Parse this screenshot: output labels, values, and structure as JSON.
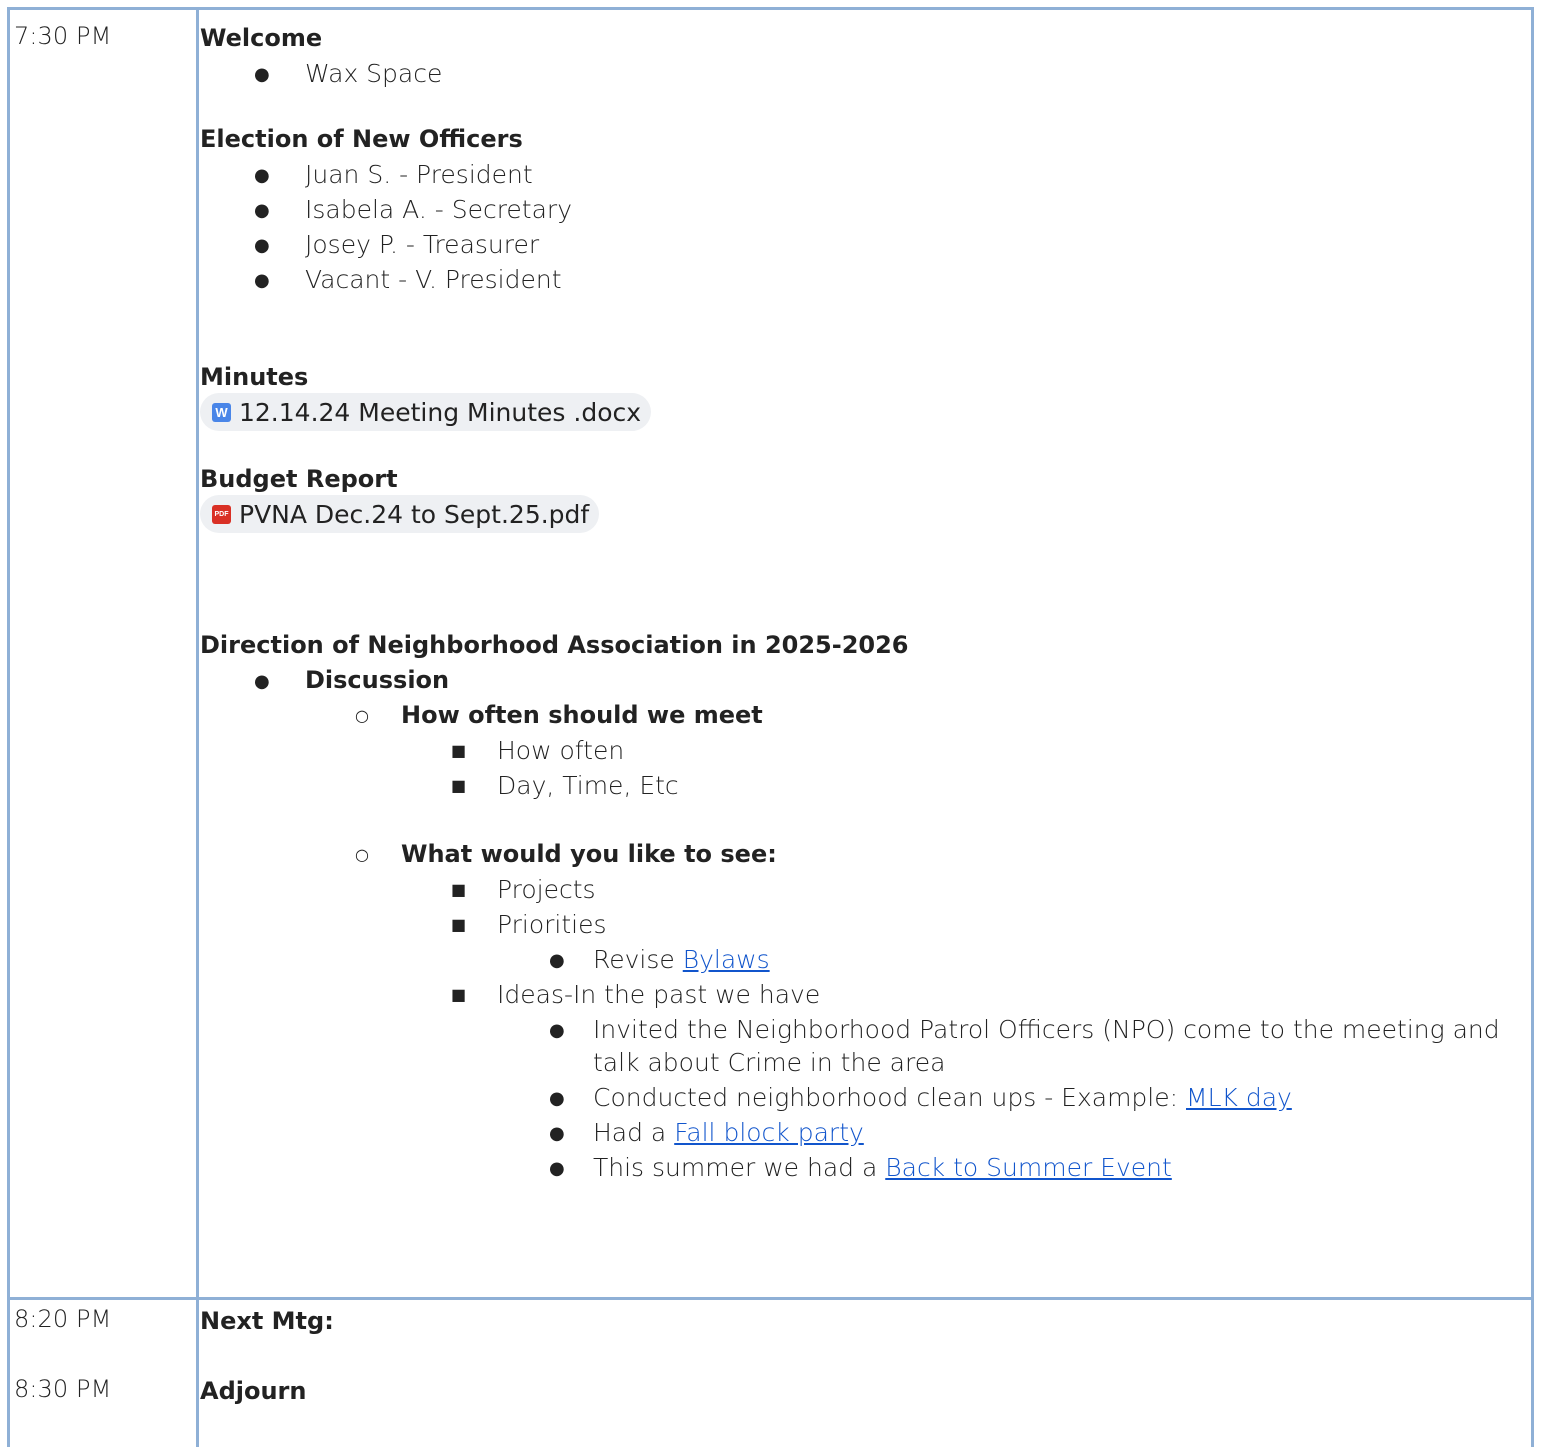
{
  "rows": [
    {
      "time": "7:30 PM",
      "sections": {
        "welcome": {
          "title": "Welcome",
          "items": [
            "Wax Space"
          ]
        },
        "election": {
          "title": "Election of New Officers",
          "items": [
            "Juan S. - President",
            "Isabela A. - Secretary",
            "Josey P. - Treasurer",
            "Vacant - V. President"
          ]
        },
        "minutes": {
          "title": "Minutes",
          "file": "12.14.24 Meeting Minutes .docx",
          "file_icon": "word-doc-icon"
        },
        "budget": {
          "title": "Budget Report",
          "file": "PVNA Dec.24 to Sept.25.pdf",
          "file_icon": "pdf-icon"
        },
        "direction": {
          "title": "Direction of Neighborhood Association in 2025-2026",
          "discussion": "Discussion",
          "meet": {
            "title": "How often should we meet",
            "items": [
              "How often",
              "Day, Time, Etc"
            ]
          },
          "see": {
            "title": "What would you like to see:",
            "projects": "Projects",
            "priorities": "Priorities",
            "revise_prefix": "Revise ",
            "revise_link": "Bylaws",
            "ideas": "Ideas-In the past we have",
            "idea1_line1": "Invited the Neighborhood Patrol Officers (NPO) come to the meeting and",
            "idea1_line2": "talk about Crime in the area",
            "idea2_prefix": "Conducted neighborhood clean ups - Example: ",
            "idea2_link": "MLK day",
            "idea3_prefix": "Had a ",
            "idea3_link": "Fall block party",
            "idea4_prefix": "This summer we had a ",
            "idea4_link": "Back to Summer Event"
          }
        }
      }
    },
    {
      "time": "8:20 PM",
      "title": "Next Mtg:"
    },
    {
      "time": "8:30 PM",
      "title": "Adjourn"
    }
  ],
  "colors": {
    "border": "#8fb0d6",
    "link": "#1155cc",
    "chip": "#eef0f3",
    "word": "#4a86e8",
    "pdf": "#d93025"
  }
}
